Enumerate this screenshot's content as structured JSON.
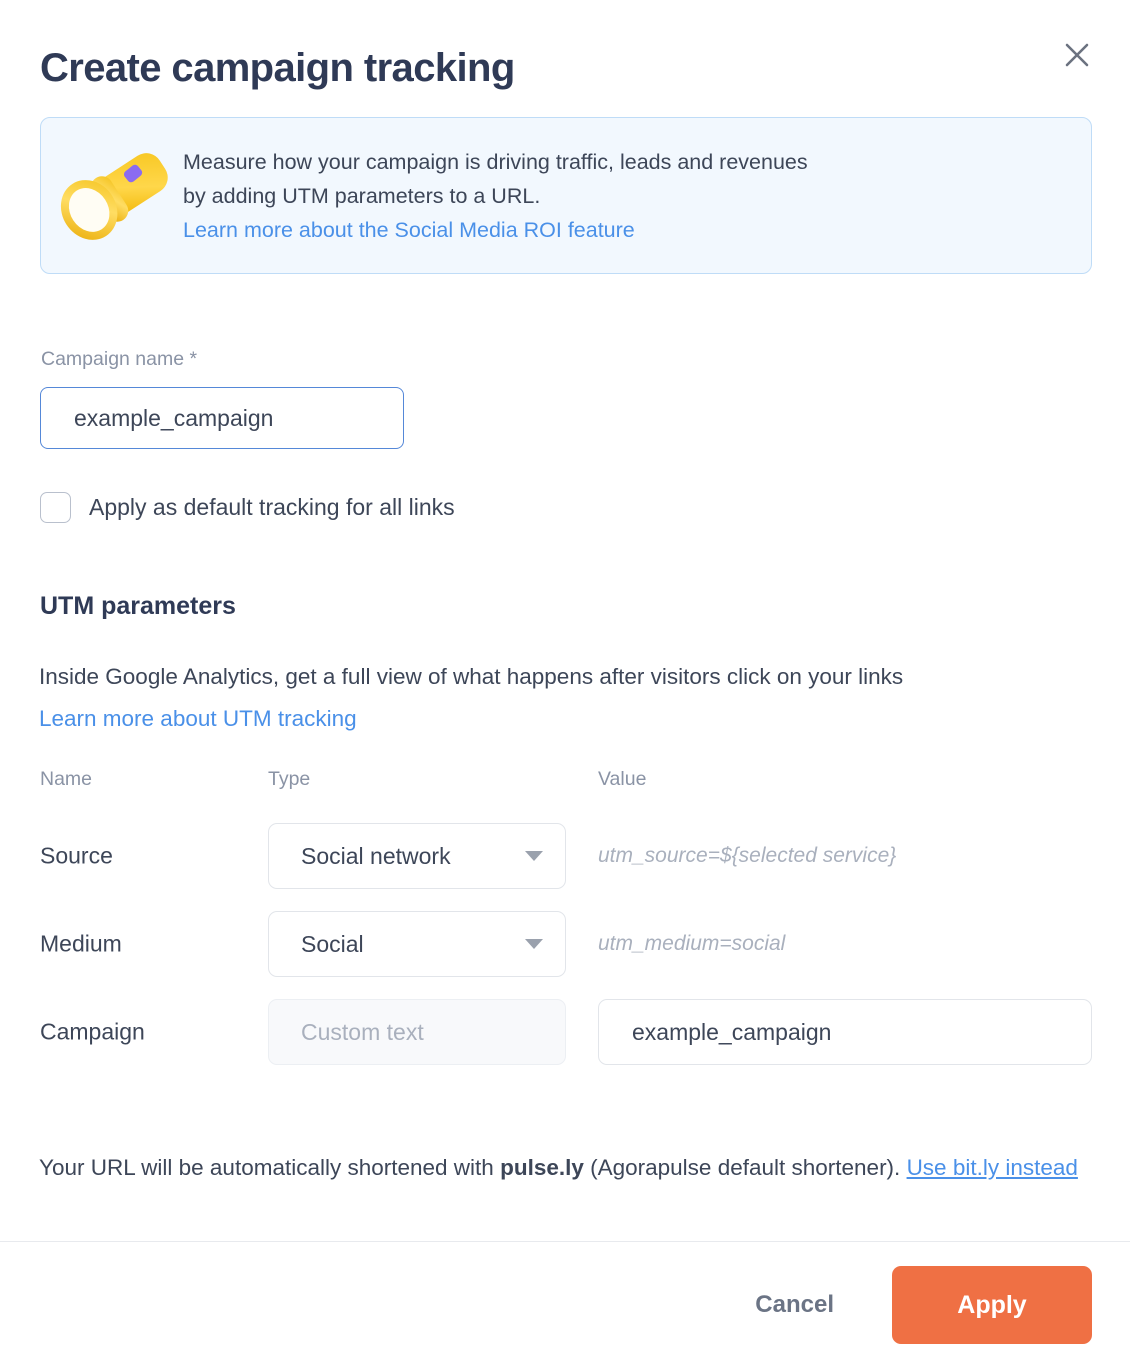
{
  "dialog": {
    "title": "Create campaign tracking",
    "close_icon": "close-icon"
  },
  "banner": {
    "icon": "flashlight-icon",
    "text_line1": "Measure how your campaign is driving traffic, leads and revenues",
    "text_line2": "by adding UTM parameters to a URL.",
    "link": "Learn more about the Social Media ROI feature",
    "background": "#f2f8fe",
    "border": "#bfdcf7",
    "link_color": "#4a90e8"
  },
  "campaign": {
    "label": "Campaign name *",
    "value": "example_campaign",
    "placeholder": ""
  },
  "default_tracking": {
    "label": "Apply as default tracking for all links",
    "checked": false
  },
  "utm": {
    "section_title": "UTM parameters",
    "description": "Inside Google Analytics, get a full view of what happens after visitors click on your links",
    "link": "Learn more about UTM tracking",
    "columns": {
      "name": "Name",
      "type": "Type",
      "value": "Value"
    },
    "rows": [
      {
        "name": "Source",
        "type_value": "Social network",
        "type_kind": "select",
        "type_disabled": false,
        "value_kind": "hint",
        "value_text": "utm_source=${selected service}"
      },
      {
        "name": "Medium",
        "type_value": "Social",
        "type_kind": "select",
        "type_disabled": false,
        "value_kind": "hint",
        "value_text": "utm_medium=social"
      },
      {
        "name": "Campaign",
        "type_value": "Custom text",
        "type_kind": "select",
        "type_disabled": true,
        "value_kind": "input",
        "value_text": "example_campaign"
      }
    ]
  },
  "shortener": {
    "text_before": "Your URL will be automatically shortened with ",
    "brand": "pulse.ly",
    "text_after": " (Agorapulse default shortener). ",
    "link": "Use bit.ly instead"
  },
  "footer": {
    "cancel_label": "Cancel",
    "apply_label": "Apply",
    "apply_color": "#ef7044"
  }
}
